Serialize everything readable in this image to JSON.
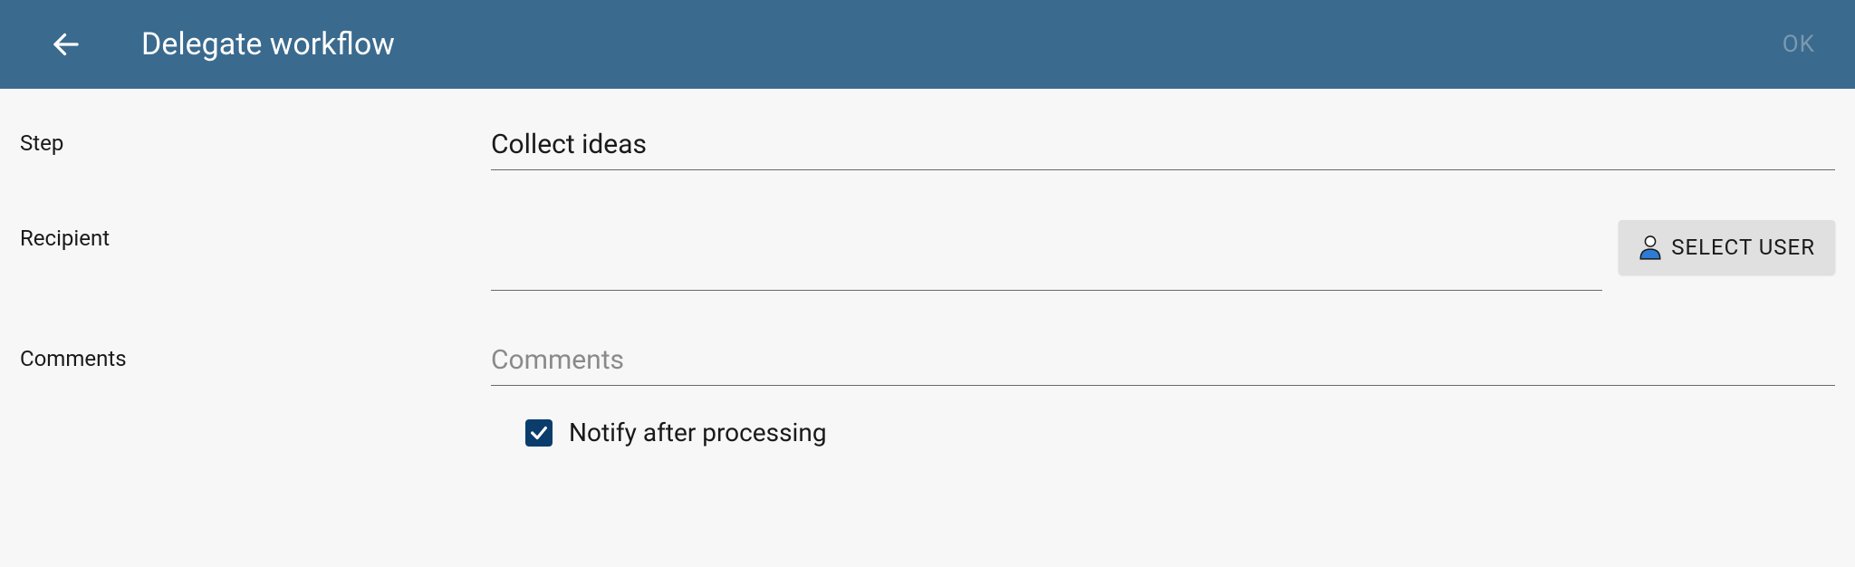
{
  "header": {
    "title": "Delegate workflow",
    "ok_label": "OK"
  },
  "form": {
    "step": {
      "label": "Step",
      "value": "Collect ideas"
    },
    "recipient": {
      "label": "Recipient",
      "value": "",
      "select_user_label": "SELECT USER"
    },
    "comments": {
      "label": "Comments",
      "placeholder": "Comments",
      "value": ""
    },
    "notify": {
      "label": "Notify after processing",
      "checked": true
    }
  }
}
